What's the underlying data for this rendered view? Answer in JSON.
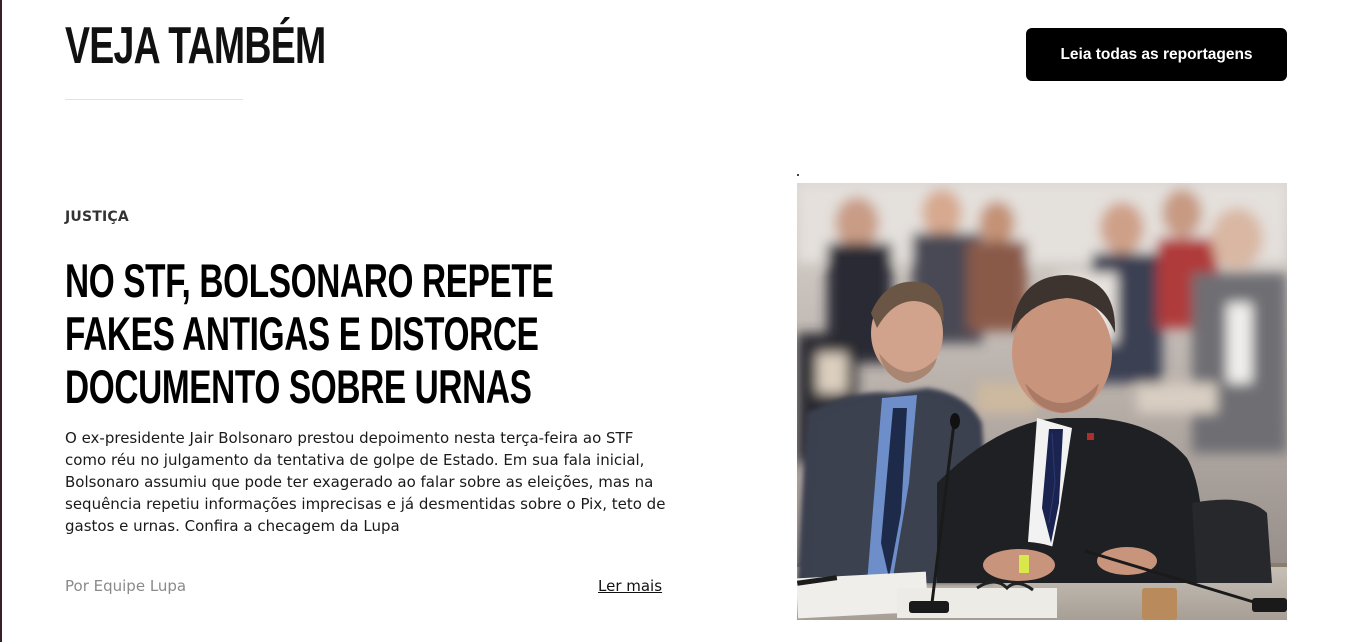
{
  "section": {
    "title": "VEJA TAMBÉM",
    "all_reports_label": "Leia todas as reportagens"
  },
  "article": {
    "category": "JUSTIÇA",
    "headline": "NO STF, BOLSONARO REPETE FAKES ANTIGAS E DISTORCE DOCUMENTO SOBRE URNAS",
    "summary": "O ex-presidente Jair Bolsonaro prestou depoimento nesta terça-feira ao STF como réu no julgamento da tentativa de golpe de Estado. Em sua fala inicial, Bolsonaro assumiu que pode ter exagerado ao falar sobre as eleições, mas na sequência repetiu informações imprecisas e já desmentidas sobre o Pix, teto de gastos e urnas. Confira a checagem da Lupa",
    "author": "Por Equipe Lupa",
    "read_more_label": "Ler mais"
  },
  "colors": {
    "button_bg": "#000000",
    "button_text": "#ffffff",
    "author_text": "#8a8a8a"
  }
}
